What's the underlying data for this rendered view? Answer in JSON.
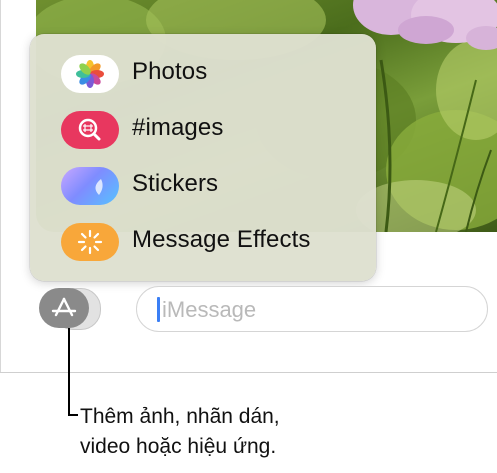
{
  "menu": {
    "items": [
      {
        "label": "Photos",
        "icon": "photos-icon"
      },
      {
        "label": "#images",
        "icon": "images-search-icon"
      },
      {
        "label": "Stickers",
        "icon": "stickers-icon"
      },
      {
        "label": "Message Effects",
        "icon": "message-effects-icon"
      }
    ]
  },
  "input": {
    "placeholder": "iMessage"
  },
  "apps_button": {
    "icon": "app-store-icon"
  },
  "callout": {
    "line1": "Thêm ảnh, nhãn dán,",
    "line2": "video hoặc hiệu ứng."
  },
  "colors": {
    "menu_background": "#dee0d0",
    "images_icon": "#e8375f",
    "effects_icon": "#f8a73a",
    "caret": "#3b7ff5",
    "app_button": "#8a8a8a"
  }
}
